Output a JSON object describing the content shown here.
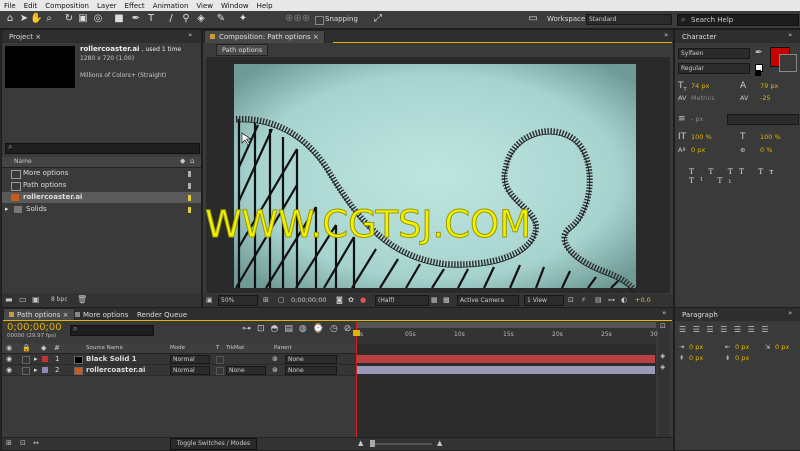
{
  "menu": [
    "File",
    "Edit",
    "Composition",
    "Layer",
    "Effect",
    "Animation",
    "View",
    "Window",
    "Help"
  ],
  "toolbar": {
    "snapping_label": "Snapping",
    "workspace_label": "Workspace:",
    "workspace_value": "Standard",
    "search_placeholder": "Search Help"
  },
  "project": {
    "tab": "Project",
    "asset_name": "rollercoaster.ai",
    "used": ", used 1 time",
    "dims": "1280 x 720 (1.00)",
    "colors": "Millions of Colors+ (Straight)",
    "column_name": "Name",
    "items": [
      {
        "label": "More options",
        "type": "comp"
      },
      {
        "label": "Path options",
        "type": "comp"
      },
      {
        "label": "rollercoaster.ai",
        "type": "ai",
        "selected": true
      },
      {
        "label": "Solids",
        "type": "folder"
      }
    ],
    "bpc": "8 bpc"
  },
  "composition": {
    "tab": "Composition: Path options",
    "sub_tab": "Path options",
    "zoom": "50%",
    "timecode": "0;00;00;00",
    "resolution": "(Half)",
    "camera": "Active Camera",
    "view": "1 View",
    "exposure": "+0.0"
  },
  "character": {
    "tab": "Character",
    "font": "Sylfaen",
    "style": "Regular",
    "size": "74 px",
    "leading": "79 px",
    "kerning": "Metrics",
    "tracking": "-25",
    "stroke": "- px",
    "vscale": "100 %",
    "hscale": "100 %",
    "baseline": "0 px",
    "tsume": "0 %",
    "fill_color": "#c80000"
  },
  "paragraph": {
    "tab": "Paragraph",
    "v1": "0 px",
    "v2": "0 px",
    "v3": "0 px",
    "v4": "0 px",
    "v5": "0 px"
  },
  "timeline": {
    "tabs": [
      "Path options",
      "More options",
      "Render Queue"
    ],
    "timecode": "0;00;00;00",
    "fps": "00000 (29.97 fps)",
    "col_source": "Source Name",
    "col_mode": "Mode",
    "col_t": "T",
    "col_trkmat": "TrkMat",
    "col_parent": "Parent",
    "ruler": [
      "0s",
      "05s",
      "10s",
      "15s",
      "20s",
      "25s",
      "30s"
    ],
    "layers": [
      {
        "num": "1",
        "name": "Black Solid 1",
        "mode": "Normal",
        "trkmat": "",
        "parent": "None",
        "color": "#c83232",
        "bar": "#b84040"
      },
      {
        "num": "2",
        "name": "rollercoaster.ai",
        "mode": "Normal",
        "trkmat": "None",
        "parent": "None",
        "color": "#8a8ab4",
        "bar": "#9a9ab8"
      }
    ],
    "toggle": "Toggle Switches / Modes"
  },
  "watermark": "WWW.CGTSJ.COM"
}
